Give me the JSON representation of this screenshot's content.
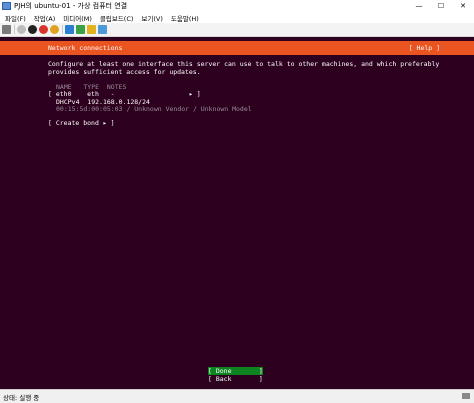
{
  "window": {
    "title": "PJH의 ubuntu-01 - 가상 컴퓨터 연결",
    "minimize": "—",
    "maximize": "☐",
    "close": "✕"
  },
  "menu": [
    "파일(F)",
    "작업(A)",
    "미디어(M)",
    "클립보드(C)",
    "보기(V)",
    "도움말(H)"
  ],
  "toolbar_icons": [
    "ctrl-alt-del-icon",
    "start-icon",
    "turn-off-icon",
    "shutdown-icon",
    "save-icon",
    "pause-icon",
    "reset-icon",
    "checkpoint-icon",
    "revert-icon"
  ],
  "console": {
    "header_title": "Network connections",
    "help_label": "[ Help ]",
    "intro_line1": "Configure at least one interface this server can use to talk to other machines, and which preferably",
    "intro_line2": "provides sufficient access for updates.",
    "table_header": "NAME   TYPE  NOTES",
    "iface_row": "[ eth0    eth   -                   ▸ ]",
    "dhcp_row": "DHCPv4  192.168.0.128/24",
    "mac_row": "00:15:5d:00:05:03 / Unknown Vendor / Unknown Model",
    "create_bond": "[ Create bond ▸ ]",
    "done_label": "[ Done       ]",
    "back_label": "[ Back       ]"
  },
  "status": {
    "text": "상태: 실행 중"
  },
  "colors": {
    "console_bg": "#2c001e",
    "header_orange": "#e95420",
    "done_green": "#0e8420"
  }
}
